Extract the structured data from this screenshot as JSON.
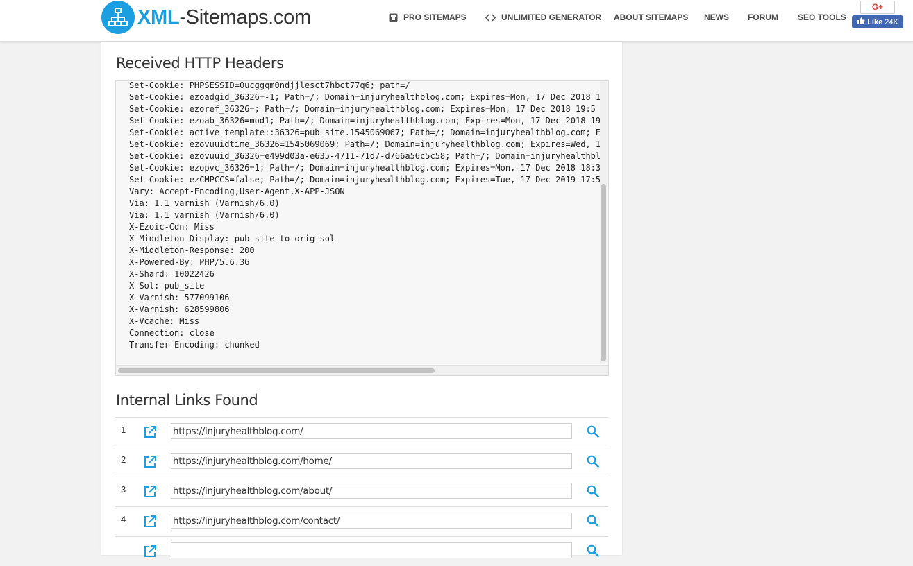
{
  "header": {
    "logo_brand": "XML",
    "logo_rest": "-Sitemaps.com",
    "nav": [
      {
        "label": "PRO SITEMAPS",
        "icon": "box-icon"
      },
      {
        "label": "UNLIMITED GENERATOR",
        "icon": "code-icon"
      },
      {
        "label": "ABOUT SITEMAPS"
      },
      {
        "label": "NEWS"
      },
      {
        "label": "FORUM"
      },
      {
        "label": "SEO TOOLS"
      }
    ],
    "gplus_label": "G+",
    "fb_like_label": "Like",
    "fb_like_count": "24K"
  },
  "http_headers": {
    "title": "Received HTTP Headers",
    "lines": [
      "Set-Cookie: PHPSESSID=0ucggqm0ndjjlesct7hbct77q6; path=/",
      "Set-Cookie: ezoadgid_36326=-1; Path=/; Domain=injuryhealthblog.com; Expires=Mon, 17 Dec 2018 1",
      "Set-Cookie: ezoref_36326=; Path=/; Domain=injuryhealthblog.com; Expires=Mon, 17 Dec 2018 19:5",
      "Set-Cookie: ezoab_36326=mod1; Path=/; Domain=injuryhealthblog.com; Expires=Mon, 17 Dec 2018 19",
      "Set-Cookie: active_template::36326=pub_site.1545069067; Path=/; Domain=injuryhealthblog.com; E",
      "Set-Cookie: ezovuuidtime_36326=1545069069; Path=/; Domain=injuryhealthblog.com; Expires=Wed, 1",
      "Set-Cookie: ezovuuid_36326=e499d03a-e635-4711-71d7-d766a56c5c58; Path=/; Domain=injuryhealthbl",
      "Set-Cookie: ezopvc_36326=1; Path=/; Domain=injuryhealthblog.com; Expires=Mon, 17 Dec 2018 18:3",
      "Set-Cookie: ezCMPCCS=false; Path=/; Domain=injuryhealthblog.com; Expires=Tue, 17 Dec 2019 17:5",
      "Vary: Accept-Encoding,User-Agent,X-APP-JSON",
      "Via: 1.1 varnish (Varnish/6.0)",
      "Via: 1.1 varnish (Varnish/6.0)",
      "X-Ezoic-Cdn: Miss",
      "X-Middleton-Display: pub_site_to_orig_sol",
      "X-Middleton-Response: 200",
      "X-Powered-By: PHP/5.6.36",
      "X-Shard: 10022426",
      "X-Sol: pub_site",
      "X-Varnish: 577099106",
      "X-Varnish: 628599806",
      "X-Vcache: Miss",
      "Connection: close",
      "Transfer-Encoding: chunked"
    ]
  },
  "internal_links": {
    "title": "Internal Links Found",
    "rows": [
      {
        "num": "1",
        "url": "https://injuryhealthblog.com/"
      },
      {
        "num": "2",
        "url": "https://injuryhealthblog.com/home/"
      },
      {
        "num": "3",
        "url": "https://injuryhealthblog.com/about/"
      },
      {
        "num": "4",
        "url": "https://injuryhealthblog.com/contact/"
      }
    ]
  },
  "colors": {
    "accent": "#1b9fe0",
    "facebook": "#4267b2",
    "gplus": "#dd4b39"
  }
}
